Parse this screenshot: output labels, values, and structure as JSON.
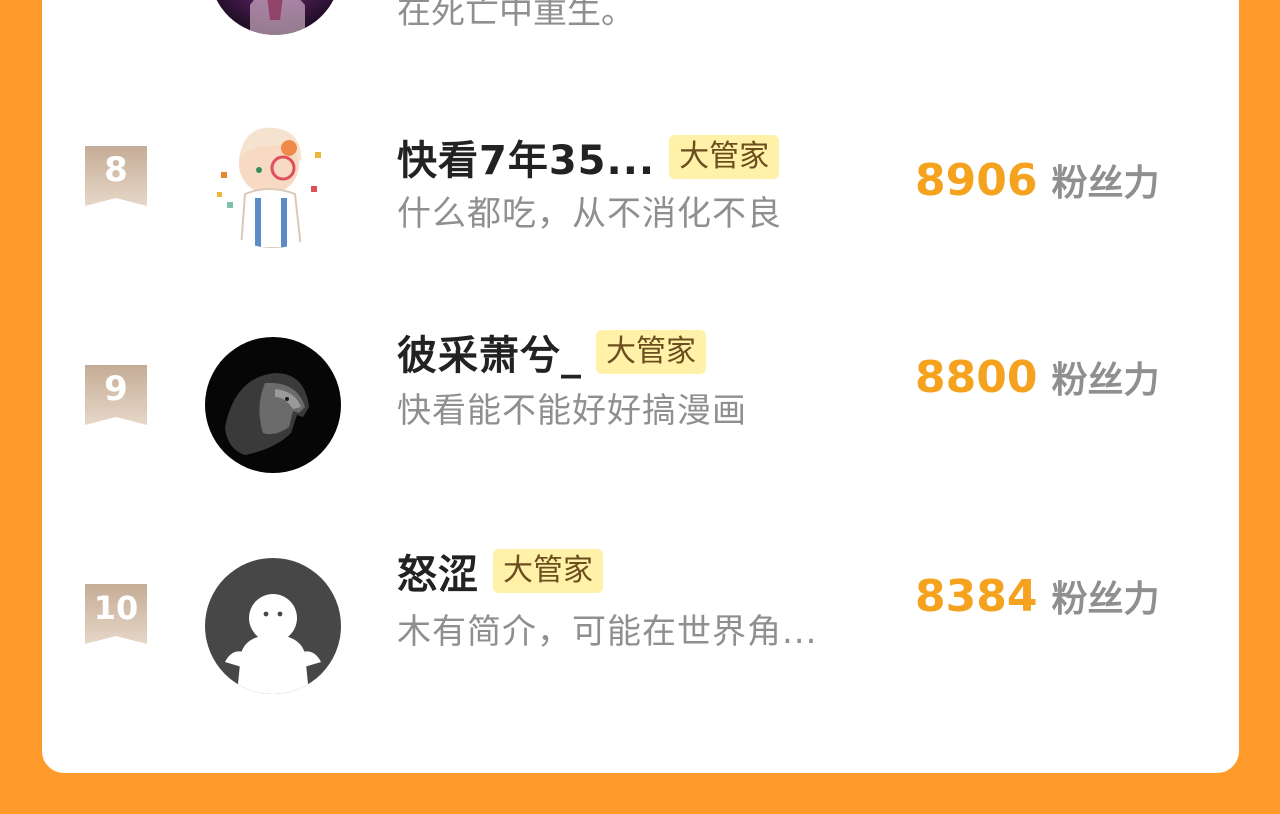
{
  "previous_row": {
    "bio_fragment": "在死亡中重生。"
  },
  "rows": [
    {
      "rank": "8",
      "name": "快看7年35...",
      "tag": "大管家",
      "bio": "什么都吃，从不消化不良",
      "score": "8906",
      "score_unit": "粉丝力"
    },
    {
      "rank": "9",
      "name": "彼采萧兮_",
      "tag": "大管家",
      "bio": "快看能不能好好搞漫画",
      "score": "8800",
      "score_unit": "粉丝力"
    },
    {
      "rank": "10",
      "name": "怒涩",
      "tag": "大管家",
      "bio": "木有简介，可能在世界角...",
      "score": "8384",
      "score_unit": "粉丝力"
    }
  ],
  "colors": {
    "background": "#ff9b2b",
    "score": "#f5a21f",
    "tag_bg": "#fff2a8",
    "rank_badge": "#c9b19a"
  },
  "icons": [
    "rank-ribbon-icon",
    "avatar-anime-icon",
    "avatar-lion-icon",
    "avatar-default-icon"
  ]
}
